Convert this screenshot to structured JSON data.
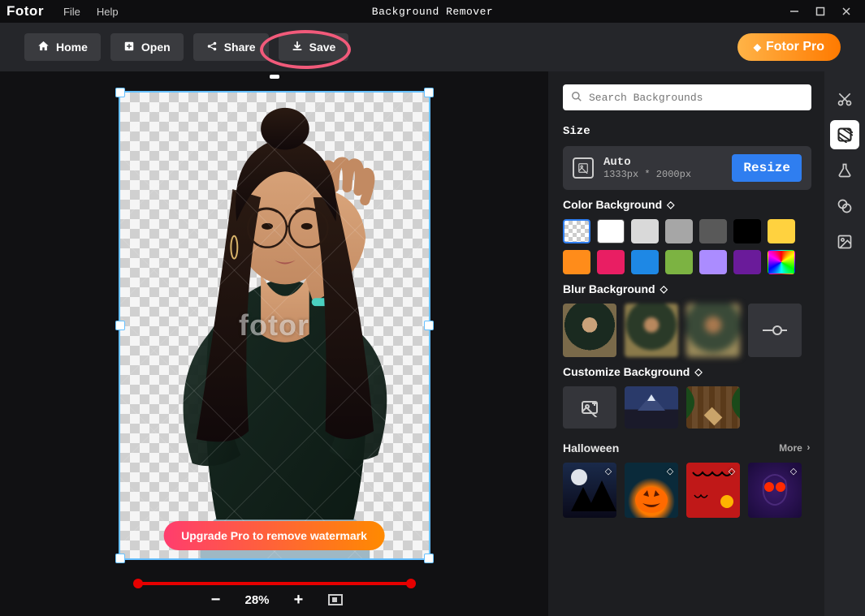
{
  "app": {
    "name": "Fotor",
    "menu": [
      "File",
      "Help"
    ],
    "title": "Background Remover"
  },
  "toolbar": {
    "home": "Home",
    "open": "Open",
    "share": "Share",
    "save": "Save",
    "pro": "Fotor Pro"
  },
  "canvas": {
    "watermark_text": "fotor",
    "upgrade_label": "Upgrade Pro to remove watermark",
    "zoom": "28%"
  },
  "panel": {
    "search_placeholder": "Search Backgrounds",
    "size_title": "Size",
    "size_auto": "Auto",
    "size_dims": "1333px * 2000px",
    "resize": "Resize",
    "color_bg_title": "Color Background",
    "colors": [
      "transparent",
      "#ffffff",
      "#d9d9d9",
      "#a6a6a6",
      "#595959",
      "#000000",
      "#ffd23f",
      "#ff8c1a",
      "#e91e63",
      "#1e88e5",
      "#7cb342",
      "#ab8cff",
      "#6a1b9a",
      "rainbow"
    ],
    "blur_bg_title": "Blur Background",
    "customize_title": "Customize Background",
    "halloween_title": "Halloween",
    "more": "More"
  },
  "rail": {
    "items": [
      "cut-icon",
      "background-icon",
      "flask-icon",
      "overlap-icon",
      "image-icon"
    ]
  }
}
